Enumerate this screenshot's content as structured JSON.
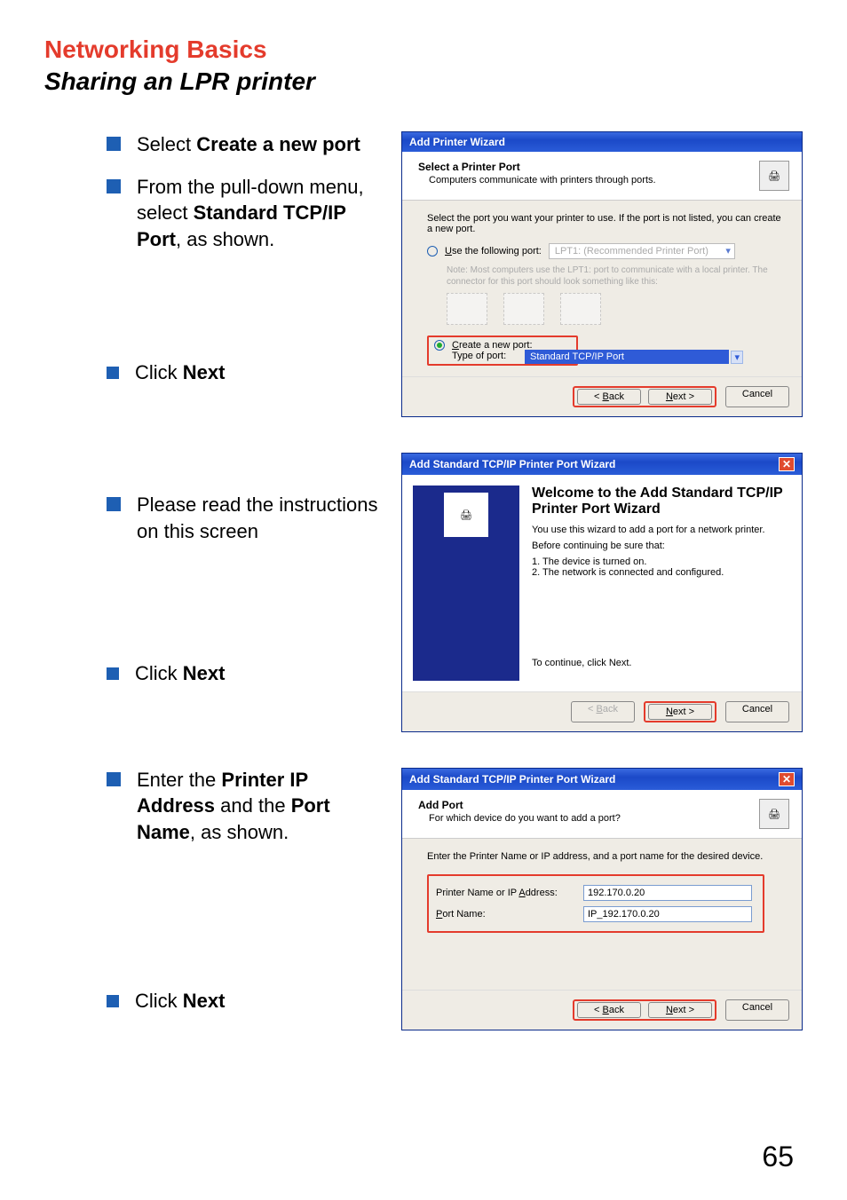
{
  "page": {
    "heading": "Networking Basics",
    "subheading": "Sharing an LPR printer",
    "number": "65"
  },
  "instructions": {
    "i1_pre": "Select ",
    "i1_bold": "Create a new port",
    "i2_pre": "From the pull-down menu, select ",
    "i2_bold": "Standard TCP/IP Port",
    "i2_post": ", as shown.",
    "i3_pre": "Click ",
    "i3_bold": "Next",
    "i4": "Please read the instructions on this screen",
    "i5_pre": "Click ",
    "i5_bold": "Next",
    "i6_pre": "Enter the ",
    "i6_b1": "Printer IP Address",
    "i6_mid": " and the ",
    "i6_b2": "Port Name",
    "i6_post": ", as shown.",
    "i7_pre": "Click ",
    "i7_bold": "Next"
  },
  "wiz1": {
    "title": "Add Printer Wizard",
    "heading": "Select a Printer Port",
    "sub": "Computers communicate with printers through ports.",
    "body_intro": "Select the port you want your printer to use.  If the port is not listed, you can create a new port.",
    "opt_use": "Use the following port:",
    "opt_use_value": "LPT1: (Recommended Printer Port)",
    "note": "Note: Most computers use the LPT1: port to communicate with a local printer. The connector for this port should look something like this:",
    "opt_create": "Create a new port:",
    "type_label": "Type of port:",
    "type_value": "Standard TCP/IP Port",
    "back": "< Back",
    "next": "Next >",
    "cancel": "Cancel"
  },
  "wiz2": {
    "title": "Add Standard TCP/IP Printer Port Wizard",
    "welcome": "Welcome to the Add Standard TCP/IP Printer Port Wizard",
    "desc": "You use this wizard to add a port for a network printer.",
    "before": "Before continuing be sure that:",
    "before1": "1.  The device is turned on.",
    "before2": "2.  The network is connected and configured.",
    "cont": "To continue, click Next.",
    "back": "< Back",
    "next": "Next >",
    "cancel": "Cancel"
  },
  "wiz3": {
    "title": "Add Standard TCP/IP Printer Port Wizard",
    "heading": "Add Port",
    "sub": "For which device do you want to add a port?",
    "instr": "Enter the Printer Name or IP address, and a port name for the desired device.",
    "lbl_ip": "Printer Name or IP Address:",
    "val_ip": "192.170.0.20",
    "lbl_port": "Port Name:",
    "val_port": "IP_192.170.0.20",
    "back": "< Back",
    "next": "Next >",
    "cancel": "Cancel"
  }
}
